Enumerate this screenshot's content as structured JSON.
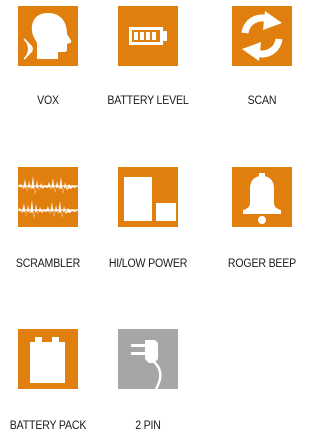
{
  "colors": {
    "accent": "#e07f0e",
    "inactive": "#a6a6a6",
    "icon": "#ffffff",
    "text": "#1a1a1a"
  },
  "features": [
    {
      "label": "VOX",
      "icon": "speaking-head-icon",
      "color": "#e07f0e"
    },
    {
      "label": "BATTERY LEVEL",
      "icon": "battery-level-icon",
      "color": "#e07f0e"
    },
    {
      "label": "SCAN",
      "icon": "scan-arrows-icon",
      "color": "#e07f0e"
    },
    {
      "label": "SCRAMBLER",
      "icon": "scrambled-waveform-icon",
      "color": "#e07f0e"
    },
    {
      "label": "HI/LOW POWER",
      "icon": "power-level-blocks-icon",
      "color": "#e07f0e"
    },
    {
      "label": "ROGER BEEP",
      "icon": "bell-icon",
      "color": "#e07f0e"
    },
    {
      "label": "BATTERY PACK",
      "icon": "battery-pack-icon",
      "color": "#e07f0e"
    },
    {
      "label": "2 PIN",
      "icon": "two-pin-plug-icon",
      "color": "#a6a6a6"
    }
  ]
}
